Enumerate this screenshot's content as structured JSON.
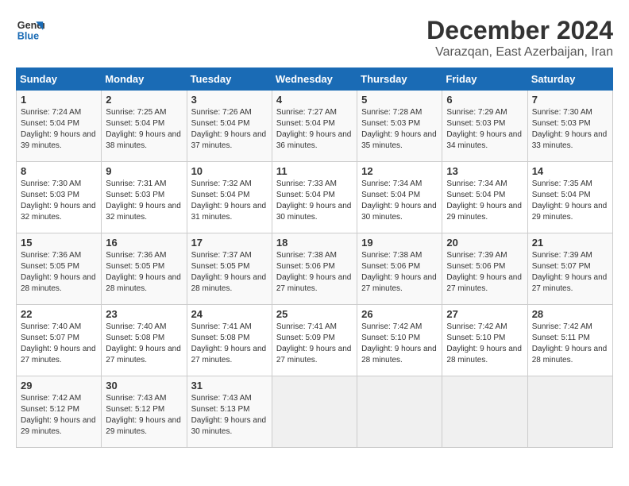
{
  "header": {
    "logo_line1": "General",
    "logo_line2": "Blue",
    "title": "December 2024",
    "subtitle": "Varazqan, East Azerbaijan, Iran"
  },
  "days_of_week": [
    "Sunday",
    "Monday",
    "Tuesday",
    "Wednesday",
    "Thursday",
    "Friday",
    "Saturday"
  ],
  "weeks": [
    [
      {
        "day": "1",
        "sunrise": "Sunrise: 7:24 AM",
        "sunset": "Sunset: 5:04 PM",
        "daylight": "Daylight: 9 hours and 39 minutes."
      },
      {
        "day": "2",
        "sunrise": "Sunrise: 7:25 AM",
        "sunset": "Sunset: 5:04 PM",
        "daylight": "Daylight: 9 hours and 38 minutes."
      },
      {
        "day": "3",
        "sunrise": "Sunrise: 7:26 AM",
        "sunset": "Sunset: 5:04 PM",
        "daylight": "Daylight: 9 hours and 37 minutes."
      },
      {
        "day": "4",
        "sunrise": "Sunrise: 7:27 AM",
        "sunset": "Sunset: 5:04 PM",
        "daylight": "Daylight: 9 hours and 36 minutes."
      },
      {
        "day": "5",
        "sunrise": "Sunrise: 7:28 AM",
        "sunset": "Sunset: 5:03 PM",
        "daylight": "Daylight: 9 hours and 35 minutes."
      },
      {
        "day": "6",
        "sunrise": "Sunrise: 7:29 AM",
        "sunset": "Sunset: 5:03 PM",
        "daylight": "Daylight: 9 hours and 34 minutes."
      },
      {
        "day": "7",
        "sunrise": "Sunrise: 7:30 AM",
        "sunset": "Sunset: 5:03 PM",
        "daylight": "Daylight: 9 hours and 33 minutes."
      }
    ],
    [
      {
        "day": "8",
        "sunrise": "Sunrise: 7:30 AM",
        "sunset": "Sunset: 5:03 PM",
        "daylight": "Daylight: 9 hours and 32 minutes."
      },
      {
        "day": "9",
        "sunrise": "Sunrise: 7:31 AM",
        "sunset": "Sunset: 5:03 PM",
        "daylight": "Daylight: 9 hours and 32 minutes."
      },
      {
        "day": "10",
        "sunrise": "Sunrise: 7:32 AM",
        "sunset": "Sunset: 5:04 PM",
        "daylight": "Daylight: 9 hours and 31 minutes."
      },
      {
        "day": "11",
        "sunrise": "Sunrise: 7:33 AM",
        "sunset": "Sunset: 5:04 PM",
        "daylight": "Daylight: 9 hours and 30 minutes."
      },
      {
        "day": "12",
        "sunrise": "Sunrise: 7:34 AM",
        "sunset": "Sunset: 5:04 PM",
        "daylight": "Daylight: 9 hours and 30 minutes."
      },
      {
        "day": "13",
        "sunrise": "Sunrise: 7:34 AM",
        "sunset": "Sunset: 5:04 PM",
        "daylight": "Daylight: 9 hours and 29 minutes."
      },
      {
        "day": "14",
        "sunrise": "Sunrise: 7:35 AM",
        "sunset": "Sunset: 5:04 PM",
        "daylight": "Daylight: 9 hours and 29 minutes."
      }
    ],
    [
      {
        "day": "15",
        "sunrise": "Sunrise: 7:36 AM",
        "sunset": "Sunset: 5:05 PM",
        "daylight": "Daylight: 9 hours and 28 minutes."
      },
      {
        "day": "16",
        "sunrise": "Sunrise: 7:36 AM",
        "sunset": "Sunset: 5:05 PM",
        "daylight": "Daylight: 9 hours and 28 minutes."
      },
      {
        "day": "17",
        "sunrise": "Sunrise: 7:37 AM",
        "sunset": "Sunset: 5:05 PM",
        "daylight": "Daylight: 9 hours and 28 minutes."
      },
      {
        "day": "18",
        "sunrise": "Sunrise: 7:38 AM",
        "sunset": "Sunset: 5:06 PM",
        "daylight": "Daylight: 9 hours and 27 minutes."
      },
      {
        "day": "19",
        "sunrise": "Sunrise: 7:38 AM",
        "sunset": "Sunset: 5:06 PM",
        "daylight": "Daylight: 9 hours and 27 minutes."
      },
      {
        "day": "20",
        "sunrise": "Sunrise: 7:39 AM",
        "sunset": "Sunset: 5:06 PM",
        "daylight": "Daylight: 9 hours and 27 minutes."
      },
      {
        "day": "21",
        "sunrise": "Sunrise: 7:39 AM",
        "sunset": "Sunset: 5:07 PM",
        "daylight": "Daylight: 9 hours and 27 minutes."
      }
    ],
    [
      {
        "day": "22",
        "sunrise": "Sunrise: 7:40 AM",
        "sunset": "Sunset: 5:07 PM",
        "daylight": "Daylight: 9 hours and 27 minutes."
      },
      {
        "day": "23",
        "sunrise": "Sunrise: 7:40 AM",
        "sunset": "Sunset: 5:08 PM",
        "daylight": "Daylight: 9 hours and 27 minutes."
      },
      {
        "day": "24",
        "sunrise": "Sunrise: 7:41 AM",
        "sunset": "Sunset: 5:08 PM",
        "daylight": "Daylight: 9 hours and 27 minutes."
      },
      {
        "day": "25",
        "sunrise": "Sunrise: 7:41 AM",
        "sunset": "Sunset: 5:09 PM",
        "daylight": "Daylight: 9 hours and 27 minutes."
      },
      {
        "day": "26",
        "sunrise": "Sunrise: 7:42 AM",
        "sunset": "Sunset: 5:10 PM",
        "daylight": "Daylight: 9 hours and 28 minutes."
      },
      {
        "day": "27",
        "sunrise": "Sunrise: 7:42 AM",
        "sunset": "Sunset: 5:10 PM",
        "daylight": "Daylight: 9 hours and 28 minutes."
      },
      {
        "day": "28",
        "sunrise": "Sunrise: 7:42 AM",
        "sunset": "Sunset: 5:11 PM",
        "daylight": "Daylight: 9 hours and 28 minutes."
      }
    ],
    [
      {
        "day": "29",
        "sunrise": "Sunrise: 7:42 AM",
        "sunset": "Sunset: 5:12 PM",
        "daylight": "Daylight: 9 hours and 29 minutes."
      },
      {
        "day": "30",
        "sunrise": "Sunrise: 7:43 AM",
        "sunset": "Sunset: 5:12 PM",
        "daylight": "Daylight: 9 hours and 29 minutes."
      },
      {
        "day": "31",
        "sunrise": "Sunrise: 7:43 AM",
        "sunset": "Sunset: 5:13 PM",
        "daylight": "Daylight: 9 hours and 30 minutes."
      },
      null,
      null,
      null,
      null
    ]
  ]
}
